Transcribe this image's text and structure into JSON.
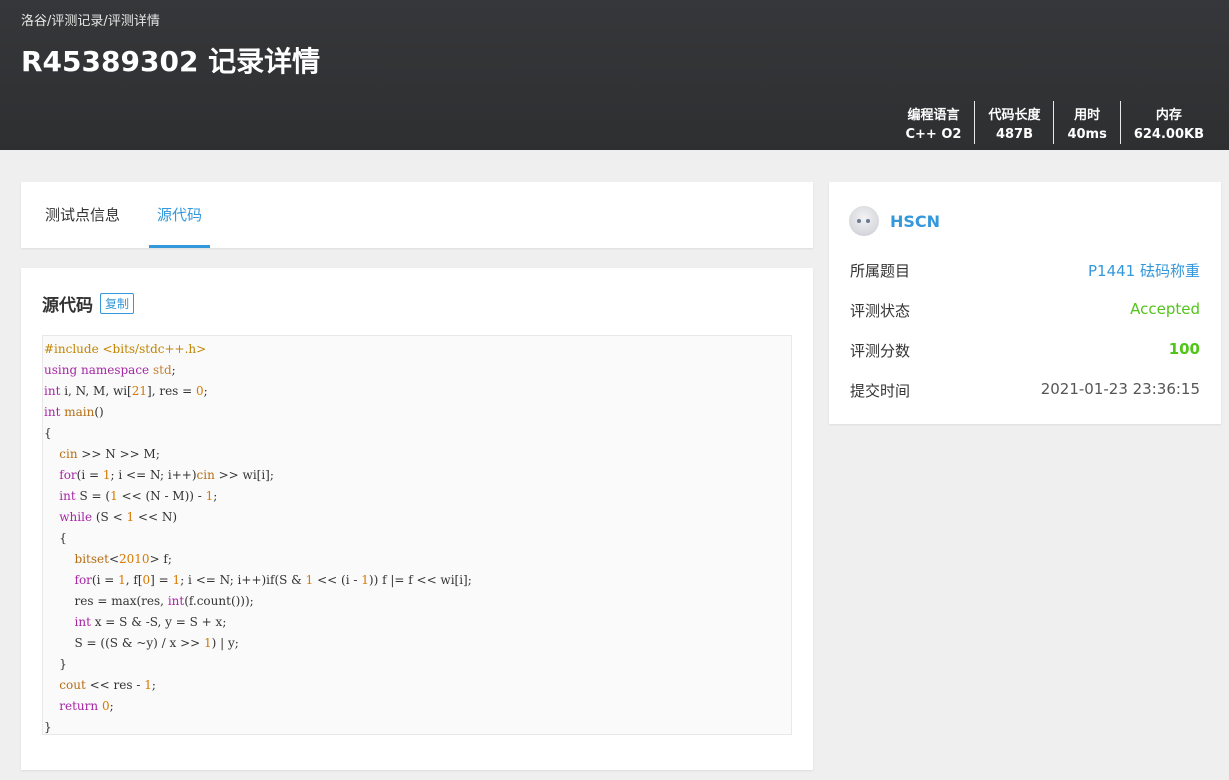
{
  "breadcrumb": [
    "洛谷",
    "评测记录",
    "评测详情"
  ],
  "breadcrumb_sep": " / ",
  "title": "R45389302 记录详情",
  "stats": [
    {
      "label": "编程语言",
      "value": "C++ O2"
    },
    {
      "label": "代码长度",
      "value": "487B"
    },
    {
      "label": "用时",
      "value": "40ms"
    },
    {
      "label": "内存",
      "value": "624.00KB"
    }
  ],
  "tabs": [
    "测试点信息",
    "源代码"
  ],
  "code_section": {
    "title": "源代码",
    "copy_label": "复制"
  },
  "code_lines": [
    "#include <bits/stdc++.h>",
    "using namespace std;",
    "int i, N, M, wi[21], res = 0;",
    "int main()",
    "{",
    "    cin >> N >> M;",
    "    for(i = 1; i <= N; i++)cin >> wi[i];",
    "    int S = (1 << (N - M)) - 1;",
    "    while (S < 1 << N)",
    "    {",
    "        bitset<2010> f;",
    "        for(i = 1, f[0] = 1; i <= N; i++)if(S & 1 << (i - 1)) f |= f << wi[i];",
    "        res = max(res, int(f.count()));",
    "        int x = S & -S, y = S + x;",
    "        S = ((S & ~y) / x >> 1) | y;",
    "    }",
    "    cout << res - 1;",
    "    return 0;",
    "}"
  ],
  "user": {
    "name": "HSCN"
  },
  "info": [
    {
      "label": "所属题目",
      "value": "P1441 砝码称重"
    },
    {
      "label": "评测状态",
      "value": "Accepted"
    },
    {
      "label": "评测分数",
      "value": "100"
    },
    {
      "label": "提交时间",
      "value": "2021-01-23 23:36:15"
    }
  ],
  "colors": {
    "accent": "#3498db",
    "accepted": "#52c41a",
    "header": "#333436"
  },
  "icons": {
    "avatar": "avatar-icon"
  }
}
